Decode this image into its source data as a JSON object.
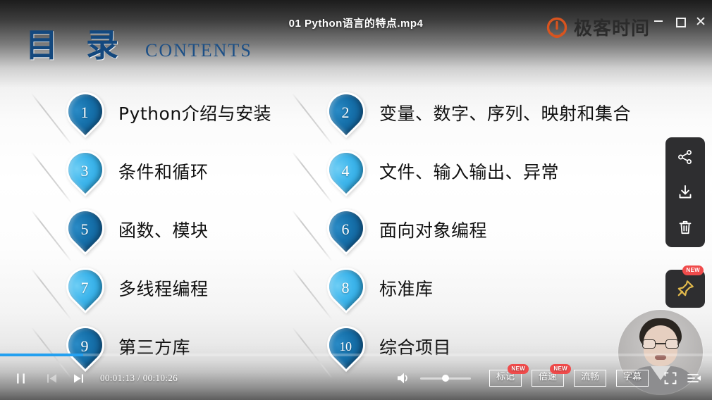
{
  "window": {
    "title": "01  Python语言的特点.mp4",
    "controls": [
      {
        "name": "minimize-button",
        "label": "—"
      },
      {
        "name": "maximize-button",
        "label": "□"
      },
      {
        "name": "close-button",
        "label": "✕"
      }
    ]
  },
  "brand": {
    "name": "极客时间",
    "mark": "geektime-logo-icon",
    "color": "#d8541f"
  },
  "slide": {
    "heading_cn": "目 录",
    "heading_en": "CONTENTS",
    "heading_color": "#13487e",
    "items": [
      {
        "number": "1",
        "label": "Python介绍与安装",
        "tone": "dark"
      },
      {
        "number": "2",
        "label": "变量、数字、序列、映射和集合",
        "tone": "dark"
      },
      {
        "number": "3",
        "label": "条件和循环",
        "tone": "light"
      },
      {
        "number": "4",
        "label": "文件、输入输出、异常",
        "tone": "light"
      },
      {
        "number": "5",
        "label": "函数、模块",
        "tone": "dark"
      },
      {
        "number": "6",
        "label": "面向对象编程",
        "tone": "dark"
      },
      {
        "number": "7",
        "label": "多线程编程",
        "tone": "light"
      },
      {
        "number": "8",
        "label": "标准库",
        "tone": "light"
      },
      {
        "number": "9",
        "label": "第三方库",
        "tone": "dark"
      },
      {
        "number": "10",
        "label": "综合项目",
        "tone": "dark"
      }
    ]
  },
  "rail": {
    "buttons": [
      {
        "name": "share-icon",
        "label": "分享"
      },
      {
        "name": "download-icon",
        "label": "下载"
      },
      {
        "name": "delete-icon",
        "label": "删除"
      }
    ],
    "pin": {
      "name": "pin-icon",
      "label": "置顶",
      "badge": "NEW"
    }
  },
  "player": {
    "play_state": "playing",
    "pause_label": "暂停",
    "prev_label": "上一集",
    "next_label": "下一集",
    "current_time": "00:01:13",
    "total_time": "00:10:26",
    "time_display": "00:01:13 / 00:10:26",
    "progress_percent": 11.7,
    "volume_percent": 50,
    "volume_label": "音量",
    "chips": [
      {
        "name": "mark-button",
        "label": "标记",
        "badge": "NEW"
      },
      {
        "name": "speed-button",
        "label": "倍速",
        "badge": "NEW"
      },
      {
        "name": "quality-button",
        "label": "流畅",
        "badge": ""
      },
      {
        "name": "subtitle-button",
        "label": "字幕",
        "badge": ""
      }
    ],
    "fullscreen_label": "全屏",
    "playlist_label": "选集"
  },
  "webcam": {
    "label": "讲师画面"
  },
  "colors": {
    "accent_blue": "#23a0f0",
    "pin_dark": "#1565a0",
    "pin_light": "#3ab4ef",
    "badge_red": "#f04b4b",
    "rail_bg": "#2e2e30"
  }
}
